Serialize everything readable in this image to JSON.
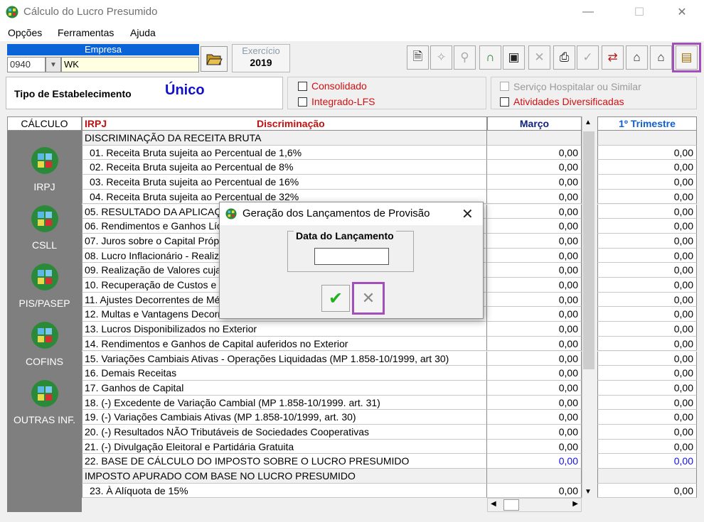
{
  "window": {
    "title": "Cálculo do Lucro Presumido",
    "minimize": "—",
    "maximize": "☐",
    "close": "✕"
  },
  "menu": [
    {
      "label": "Opções"
    },
    {
      "label": "Ferramentas"
    },
    {
      "label": "Ajuda"
    }
  ],
  "empresa": {
    "header": "Empresa",
    "code": "0940",
    "name": "WK"
  },
  "exercicio": {
    "label": "Exercício",
    "value": "2019"
  },
  "toolbar_icons": [
    "document-icon",
    "wizard-icon",
    "search-icon",
    "lock-icon",
    "save-icon",
    "delete-icon",
    "print-icon",
    "check-disabled-icon",
    "export-icon",
    "import-icon",
    "transfer-icon",
    "generate-entries-icon"
  ],
  "estabelecimento": {
    "label": "Tipo de Estabelecimento",
    "value": "Único"
  },
  "checkboxes": {
    "consolidado": "Consolidado",
    "integrado": "Integrado-LFS",
    "hospitalar": "Serviço Hospitalar ou Similar",
    "diversificadas": "Atividades Diversificadas"
  },
  "calculo": {
    "header": "CÁLCULO",
    "items": [
      "IRPJ",
      "CSLL",
      "PIS/PASEP",
      "COFINS",
      "OUTRAS INF."
    ]
  },
  "grid": {
    "col_tax": "IRPJ",
    "col_desc": "Discriminação",
    "col_month": "Março",
    "col_quarter": "1º Trimestre",
    "rows": [
      {
        "desc": "DISCRIMINAÇÃO DA RECEITA BRUTA",
        "m": "",
        "t": "",
        "type": "hdr"
      },
      {
        "desc": "01. Receita Bruta sujeita ao Percentual de 1,6%",
        "m": "0,00",
        "t": "0,00",
        "type": "indent"
      },
      {
        "desc": "02. Receita Bruta sujeita ao Percentual de 8%",
        "m": "0,00",
        "t": "0,00",
        "type": "indent"
      },
      {
        "desc": "03. Receita Bruta sujeita ao Percentual de 16%",
        "m": "0,00",
        "t": "0,00",
        "type": "indent"
      },
      {
        "desc": "04. Receita Bruta sujeita ao Percentual de 32%",
        "m": "0,00",
        "t": "0,00",
        "type": "indent"
      },
      {
        "desc": "05. RESULTADO DA APLICAÇÃO",
        "m": "0,00",
        "t": "0,00",
        "type": ""
      },
      {
        "desc": "06. Rendimentos e Ganhos Líq",
        "m": "0,00",
        "t": "0,00",
        "type": ""
      },
      {
        "desc": "07. Juros sobre o Capital Própr",
        "m": "0,00",
        "t": "0,00",
        "type": ""
      },
      {
        "desc": "08. Lucro Inflacionário - Realiza",
        "m": "0,00",
        "t": "0,00",
        "type": ""
      },
      {
        "desc": "09. Realização de Valores cuja",
        "m": "0,00",
        "t": "0,00",
        "type": ""
      },
      {
        "desc": "10. Recuperação de Custos e D",
        "m": "0,00",
        "t": "0,00",
        "type": ""
      },
      {
        "desc": "11. Ajustes Decorrentes de Mé",
        "m": "0,00",
        "t": "0,00",
        "type": ""
      },
      {
        "desc": "12. Multas e Vantagens Decorr",
        "m": "0,00",
        "t": "0,00",
        "type": ""
      },
      {
        "desc": "13. Lucros Disponibilizados no Exterior",
        "m": "0,00",
        "t": "0,00",
        "type": ""
      },
      {
        "desc": "14. Rendimentos e Ganhos de Capital auferidos no Exterior",
        "m": "0,00",
        "t": "0,00",
        "type": ""
      },
      {
        "desc": "15. Variações Cambiais Ativas - Operações Liquidadas (MP 1.858-10/1999, art 30)",
        "m": "0,00",
        "t": "0,00",
        "type": ""
      },
      {
        "desc": "16. Demais Receitas",
        "m": "0,00",
        "t": "0,00",
        "type": ""
      },
      {
        "desc": "17. Ganhos de Capital",
        "m": "0,00",
        "t": "0,00",
        "type": ""
      },
      {
        "desc": "18. (-) Excedente de Variação Cambial (MP 1.858-10/1999. art. 31)",
        "m": "0,00",
        "t": "0,00",
        "type": ""
      },
      {
        "desc": "19. (-) Variações Cambiais Ativas (MP 1.858-10/1999, art. 30)",
        "m": "0,00",
        "t": "0,00",
        "type": ""
      },
      {
        "desc": "20. (-) Resultados NÃO Tributáveis de Sociedades Cooperativas",
        "m": "0,00",
        "t": "0,00",
        "type": ""
      },
      {
        "desc": "21. (-) Divulgação Eleitoral e Partidária Gratuita",
        "m": "0,00",
        "t": "0,00",
        "type": ""
      },
      {
        "desc": "22. BASE DE CÁLCULO DO IMPOSTO SOBRE O LUCRO PRESUMIDO",
        "m": "0,00",
        "t": "0,00",
        "type": "blue"
      },
      {
        "desc": "IMPOSTO APURADO COM BASE NO LUCRO PRESUMIDO",
        "m": "",
        "t": "",
        "type": "hdr"
      },
      {
        "desc": "23. À Alíquota de 15%",
        "m": "0,00",
        "t": "0,00",
        "type": "indent"
      }
    ]
  },
  "dialog": {
    "title": "Geração dos Lançamentos de Provisão",
    "group_label": "Data do Lançamento",
    "date_value": "",
    "close": "✕",
    "ok_glyph": "✔",
    "cancel_glyph": "✕"
  }
}
